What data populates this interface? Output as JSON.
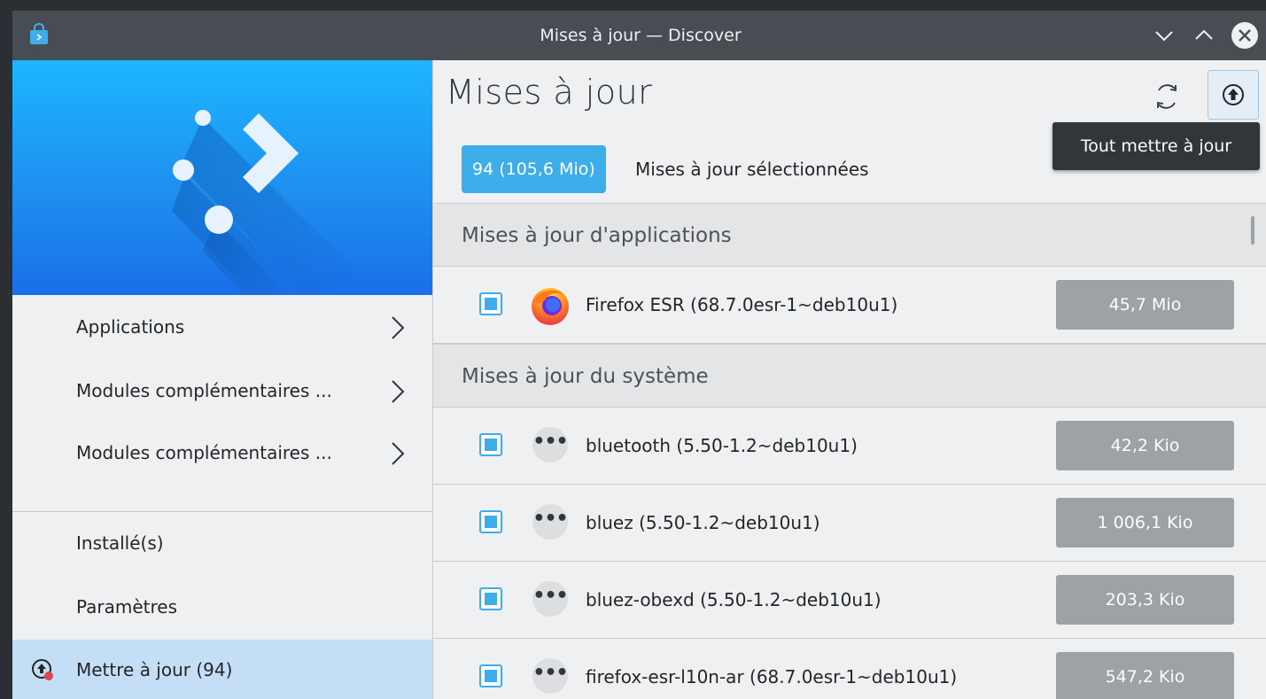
{
  "window": {
    "title": "Mises à jour — Discover"
  },
  "sidebar": {
    "items": [
      {
        "label": "Applications"
      },
      {
        "label": "Modules complémentaires ..."
      },
      {
        "label": "Modules complémentaires ..."
      },
      {
        "label": "Installé(s)"
      },
      {
        "label": "Paramètres"
      },
      {
        "label": "Mettre à jour (94)"
      }
    ]
  },
  "main": {
    "title": "Mises à jour",
    "tooltip": "Tout mettre à jour",
    "selection_badge": "94 (105,6 Mio)",
    "selection_label": "Mises à jour sélectionnées",
    "sections": [
      {
        "header": "Mises à jour d'applications",
        "items": [
          {
            "name": "Firefox ESR (68.7.0esr-1~deb10u1)",
            "size": "45,7 Mio",
            "checked": true,
            "icon": "firefox-icon"
          }
        ]
      },
      {
        "header": "Mises à jour du système",
        "items": [
          {
            "name": "bluetooth (5.50-1.2~deb10u1)",
            "size": "42,2 Kio",
            "checked": true,
            "icon": "package-icon"
          },
          {
            "name": "bluez (5.50-1.2~deb10u1)",
            "size": "1 006,1 Kio",
            "checked": true,
            "icon": "package-icon"
          },
          {
            "name": "bluez-obexd (5.50-1.2~deb10u1)",
            "size": "203,3 Kio",
            "checked": true,
            "icon": "package-icon"
          },
          {
            "name": "firefox-esr-l10n-ar (68.7.0esr-1~deb10u1)",
            "size": "547,2 Kio",
            "checked": true,
            "icon": "package-icon"
          }
        ]
      }
    ]
  },
  "colors": {
    "accent": "#3daee9",
    "selected_nav": "#c3def5",
    "titlebar": "#474d52"
  }
}
